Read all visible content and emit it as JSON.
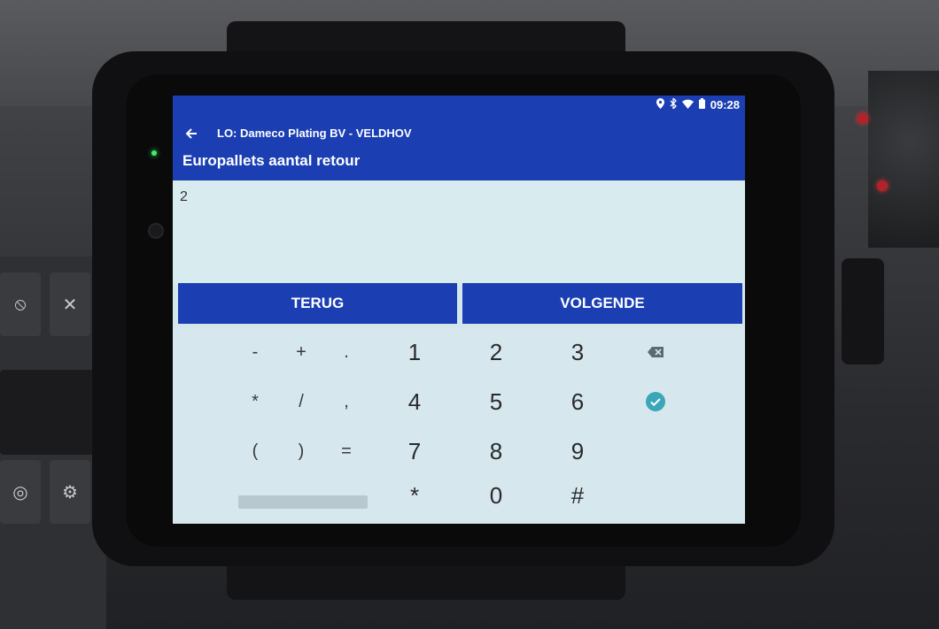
{
  "status_bar": {
    "time": "09:28",
    "icons": [
      "location-icon",
      "bluetooth-icon",
      "wifi-icon",
      "battery-icon"
    ]
  },
  "app_bar": {
    "subtitle": "LO: Dameco Plating BV - VELDHOV",
    "title": "Europallets aantal retour",
    "color": "#1b3fb3"
  },
  "input": {
    "value": "2"
  },
  "buttons": {
    "back_label": "TERUG",
    "next_label": "VOLGENDE"
  },
  "keyboard": {
    "symbols": [
      "-",
      "+",
      ".",
      "*",
      "/",
      ",",
      "(",
      ")",
      "="
    ],
    "numbers": [
      "1",
      "2",
      "3",
      "4",
      "5",
      "6",
      "7",
      "8",
      "9",
      "*",
      "0",
      "#"
    ]
  },
  "colors": {
    "accent": "#1b3fb3",
    "confirm": "#3aa6b9",
    "screen_bg": "#d6e8ed"
  }
}
